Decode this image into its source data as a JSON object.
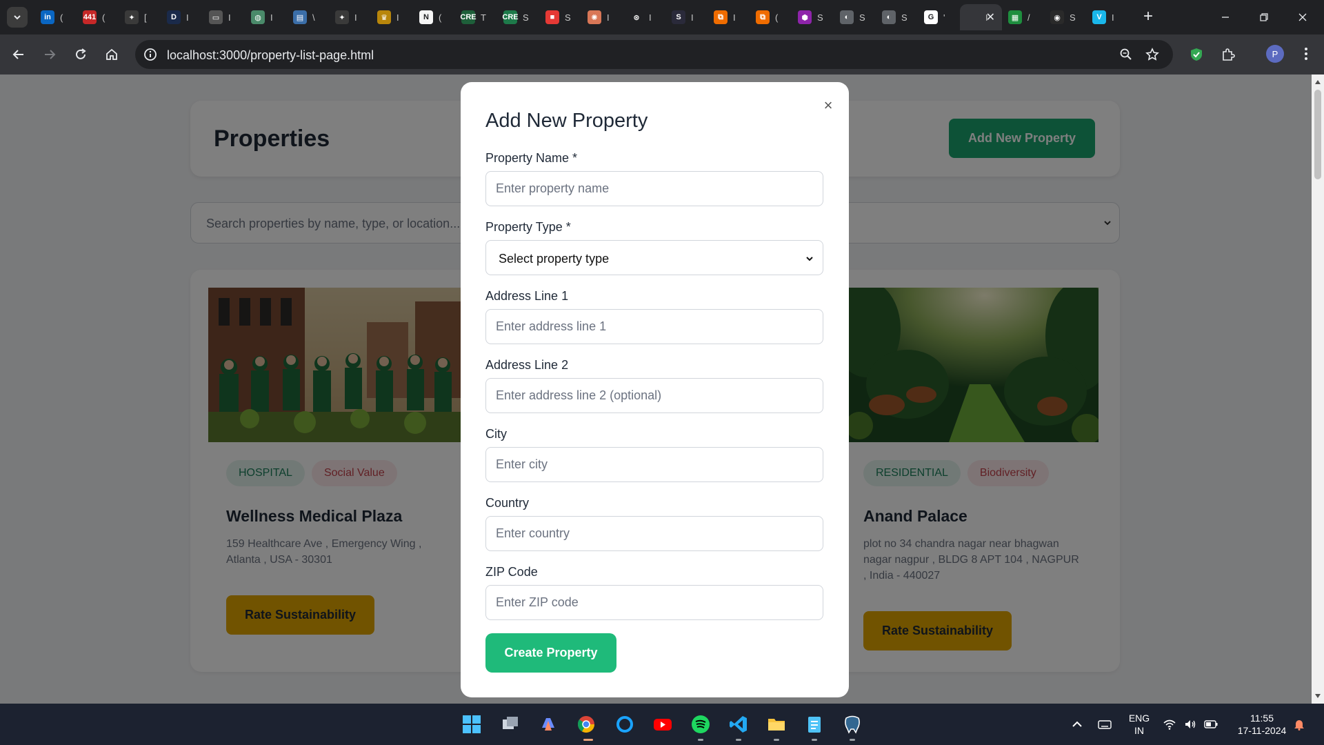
{
  "browser": {
    "url": "localhost:3000/property-list-page.html",
    "tabs": [
      {
        "icon": "linkedin-icon",
        "letter": "in",
        "color": "#0a66c2",
        "title": "("
      },
      {
        "icon": "badge-icon",
        "letter": "441",
        "color": "#c62828",
        "title": "("
      },
      {
        "icon": "bulb-icon",
        "letter": "✦",
        "color": "#3a3a3a",
        "title": "["
      },
      {
        "icon": "d-icon",
        "letter": "D",
        "color": "#1a2a4a",
        "title": "I"
      },
      {
        "icon": "page-icon",
        "letter": "▭",
        "color": "#555555",
        "title": "I"
      },
      {
        "icon": "globe-icon",
        "letter": "◍",
        "color": "#4a8a6a",
        "title": "I"
      },
      {
        "icon": "map-icon",
        "letter": "▤",
        "color": "#3b6ea8",
        "title": "\\"
      },
      {
        "icon": "sparkle-icon",
        "letter": "✦",
        "color": "#3a3a3a",
        "title": "I"
      },
      {
        "icon": "trophy-icon",
        "letter": "♛",
        "color": "#b8860b",
        "title": "I"
      },
      {
        "icon": "notion-icon",
        "letter": "N",
        "color": "#f5f5f5",
        "title": "("
      },
      {
        "icon": "cre-icon",
        "letter": "CRE",
        "color": "#1e5f3a",
        "title": "T"
      },
      {
        "icon": "cre-icon",
        "letter": "CRE",
        "color": "#1e7a4a",
        "title": "S"
      },
      {
        "icon": "windows-icon",
        "letter": "■",
        "color": "#e53935",
        "title": "S"
      },
      {
        "icon": "claude-icon",
        "letter": "✺",
        "color": "#d97757",
        "title": "I"
      },
      {
        "icon": "openai-icon",
        "letter": "⊛",
        "color": "#202124",
        "title": "I"
      },
      {
        "icon": "s-icon",
        "letter": "S",
        "color": "#2a2a3a",
        "title": "I"
      },
      {
        "icon": "copy-icon",
        "letter": "⧉",
        "color": "#ef6c00",
        "title": "I"
      },
      {
        "icon": "copy-icon",
        "letter": "⧉",
        "color": "#ef6c00",
        "title": "("
      },
      {
        "icon": "hex-icon",
        "letter": "⬢",
        "color": "#8e24aa",
        "title": "S"
      },
      {
        "icon": "globe-icon",
        "letter": "◐",
        "color": "#5f6368",
        "title": "S"
      },
      {
        "icon": "globe-icon",
        "letter": "◐",
        "color": "#5f6368",
        "title": "S"
      },
      {
        "icon": "google-icon",
        "letter": "G",
        "color": "#ffffff",
        "title": "'"
      },
      {
        "icon": "page-icon",
        "letter": "",
        "color": "#35363a",
        "title": "I",
        "active": true
      },
      {
        "icon": "sheets-icon",
        "letter": "▦",
        "color": "#1e8e3e",
        "title": "/"
      },
      {
        "icon": "dark-icon",
        "letter": "◉",
        "color": "#2a2a2a",
        "title": "S"
      },
      {
        "icon": "v-icon",
        "letter": "V",
        "color": "#1ab7ea",
        "title": "I"
      }
    ],
    "profile_letter": "P",
    "accent_shield": "#34a853"
  },
  "page": {
    "title": "Properties",
    "add_button": "Add New Property",
    "search_placeholder": "Search properties by name, type, or location...",
    "cards": [
      {
        "image_alt": "team-photo",
        "type_tag": "HOSPITAL",
        "category_tag": "Social Value",
        "name": "Wellness Medical Plaza",
        "address": "159 Healthcare Ave , Emergency Wing , Atlanta , USA - 30301",
        "button": "Rate Sustainability"
      },
      {
        "image_alt": "jungle-photo",
        "type_tag": "RESIDENTIAL",
        "category_tag": "Biodiversity",
        "name": "Anand Palace",
        "address": "plot no 34 chandra nagar near bhagwan nagar nagpur , BLDG 8 APT 104 , NAGPUR , India - 440027",
        "button": "Rate Sustainability"
      }
    ]
  },
  "modal": {
    "title": "Add New Property",
    "close": "×",
    "fields": {
      "name": {
        "label": "Property Name *",
        "placeholder": "Enter property name"
      },
      "type": {
        "label": "Property Type *",
        "value": "Select property type"
      },
      "address1": {
        "label": "Address Line 1",
        "placeholder": "Enter address line 1"
      },
      "address2": {
        "label": "Address Line 2",
        "placeholder": "Enter address line 2 (optional)"
      },
      "city": {
        "label": "City",
        "placeholder": "Enter city"
      },
      "country": {
        "label": "Country",
        "placeholder": "Enter country"
      },
      "zip": {
        "label": "ZIP Code",
        "placeholder": "Enter ZIP code"
      }
    },
    "submit": "Create Property"
  },
  "taskbar": {
    "lang_top": "ENG",
    "lang_bottom": "IN",
    "time": "11:55",
    "date": "17-11-2024"
  },
  "colors": {
    "primary_green": "#1aa56f",
    "create_green": "#1fba7a",
    "rate_gold": "#e2a700"
  }
}
